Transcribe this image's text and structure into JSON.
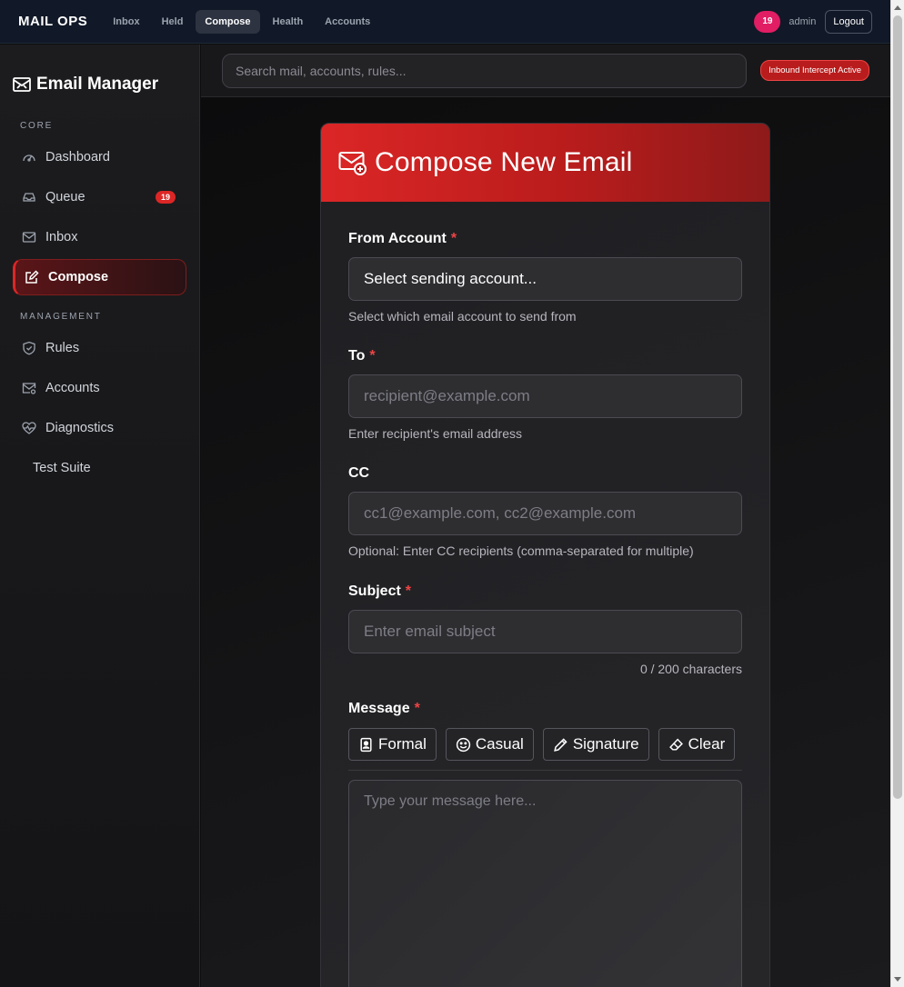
{
  "topnav": {
    "brand": "MAIL OPS",
    "links": [
      "Inbox",
      "Held",
      "Compose",
      "Health",
      "Accounts"
    ],
    "active": "Compose",
    "count": "19",
    "user": "admin",
    "logout": "Logout"
  },
  "sidebar": {
    "title": "Email Manager",
    "sections": {
      "core": "CORE",
      "management": "MANAGEMENT"
    },
    "items": {
      "dashboard": "Dashboard",
      "queue": "Queue",
      "queue_badge": "19",
      "inbox": "Inbox",
      "compose": "Compose",
      "rules": "Rules",
      "accounts": "Accounts",
      "diagnostics": "Diagnostics",
      "test_suite": "Test Suite"
    }
  },
  "search": {
    "placeholder": "Search mail, accounts, rules..."
  },
  "status_badge": "Inbound Intercept Active",
  "compose": {
    "title": "Compose New Email",
    "from": {
      "label": "From Account",
      "value": "Select sending account...",
      "help": "Select which email account to send from"
    },
    "to": {
      "label": "To",
      "placeholder": "recipient@example.com",
      "help": "Enter recipient's email address"
    },
    "cc": {
      "label": "CC",
      "placeholder": "cc1@example.com, cc2@example.com",
      "help": "Optional: Enter CC recipients (comma-separated for multiple)"
    },
    "subject": {
      "label": "Subject",
      "placeholder": "Enter email subject",
      "counter": "0 / 200 characters"
    },
    "message": {
      "label": "Message",
      "placeholder": "Type your message here...",
      "templates": {
        "formal": "Formal",
        "casual": "Casual",
        "signature": "Signature",
        "clear": "Clear"
      }
    },
    "required_mark": "*"
  },
  "colors": {
    "accent": "#dc2626",
    "badge_pink": "#e11d63",
    "nav_bg": "#111827"
  }
}
